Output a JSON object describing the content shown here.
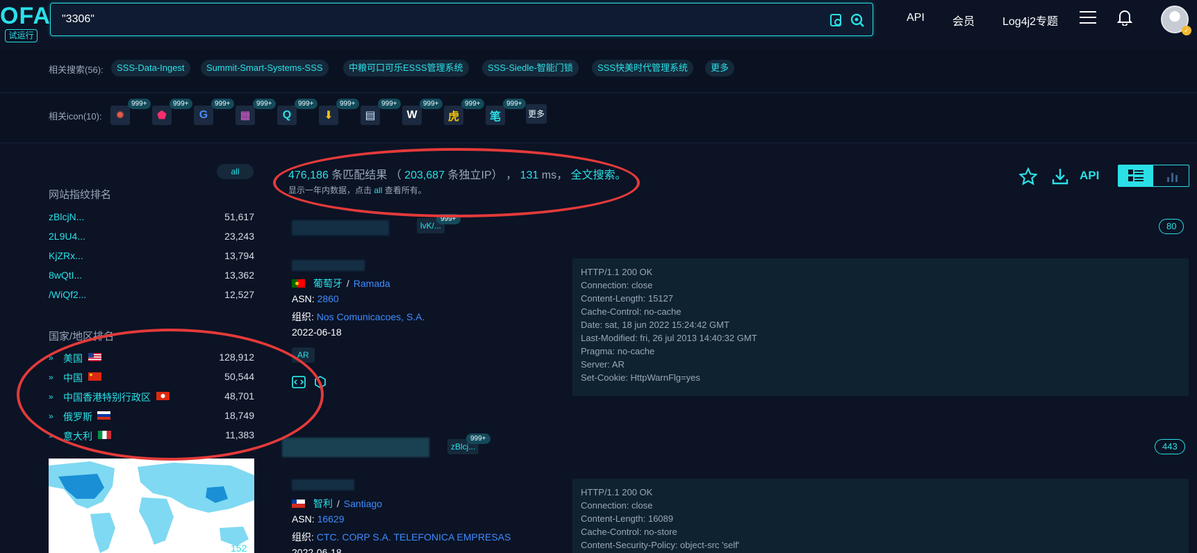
{
  "header": {
    "logo_text": "OFA",
    "logo_badge": "试运行",
    "search_value": "\"3306\"",
    "nav": [
      "API",
      "会员",
      "Log4j2专题"
    ]
  },
  "related_search": {
    "label": "相关搜索(56):",
    "items": [
      "SSS-Data-Ingest",
      "Summit-Smart-Systems-SSS",
      "中粮可口可乐ESSS管理系统",
      "SSS-Siedle-智能门锁",
      "SSS快美时代管理系统",
      "更多"
    ]
  },
  "related_icons": {
    "label": "相关icon(10):",
    "badges": [
      "999+",
      "999+",
      "999+",
      "999+",
      "999+",
      "999+",
      "999+",
      "999+",
      "999+",
      "999+"
    ],
    "glyphs": [
      "✹",
      "⬟",
      "G",
      "▦",
      "Q",
      "⬇",
      "▤",
      "W",
      "虎",
      "笔"
    ],
    "more": "更多"
  },
  "sidebar": {
    "all_label": "all",
    "fingerprint_title": "网站指纹排名",
    "fingerprints": [
      {
        "name": "zBlcjN...",
        "count": "51,617"
      },
      {
        "name": "2L9U4...",
        "count": "23,243"
      },
      {
        "name": "KjZRx...",
        "count": "13,794"
      },
      {
        "name": "8wQtI...",
        "count": "13,362"
      },
      {
        "name": "/WiQf2...",
        "count": "12,527"
      }
    ],
    "country_title": "国家/地区排名",
    "countries": [
      {
        "name": "美国",
        "count": "128,912"
      },
      {
        "name": "中国",
        "count": "50,544"
      },
      {
        "name": "中国香港特别行政区",
        "count": "48,701"
      },
      {
        "name": "俄罗斯",
        "count": "18,749"
      },
      {
        "name": "意大利",
        "count": "11,383"
      }
    ],
    "map_label": "152"
  },
  "summary": {
    "total": "476,186",
    "total_suffix": "条匹配结果",
    "paren_open": "（",
    "ip_count": "203,687",
    "ip_suffix": "条独立IP）",
    "comma": "，",
    "ms": "131",
    "ms_suffix": "ms，",
    "fulltext": "全文搜索。",
    "note_prefix": "显示一年内数据，点击",
    "note_all": "all",
    "note_suffix": "查看所有。",
    "api_label": "API"
  },
  "results": [
    {
      "ip_partial": "152.153",
      "tag": "lvK/...",
      "tag_count": "999+",
      "port": "80",
      "country": "葡萄牙",
      "city": "Ramada",
      "asn_label": "ASN:",
      "asn": "2860",
      "org_label": "组织:",
      "org": "Nos Comunicacoes, S.A.",
      "date": "2022-06-18",
      "product": "AR",
      "http": [
        "HTTP/1.1 200 OK",
        "Connection: close",
        "Content-Length: 15127",
        "Cache-Control: no-cache",
        "Date: sat, 18 jun 2022 15:24:42 GMT",
        "Last-Modified: fri, 26 jul 2013 14:40:32 GMT",
        "Pragma: no-cache",
        "Server: AR",
        "Set-Cookie: HttpWarnFlg=yes"
      ]
    },
    {
      "tag": "zBlcj...",
      "tag_count": "999+",
      "port": "443",
      "country": "智利",
      "city": "Santiago",
      "asn_label": "ASN:",
      "asn": "16629",
      "org_label": "组织:",
      "org": "CTC. CORP S.A. TELEFONICA EMPRESAS",
      "date": "2022-06-18",
      "http": [
        "HTTP/1.1 200 OK",
        "Connection: close",
        "Content-Length: 16089",
        "Cache-Control: no-store",
        "Content-Security-Policy: object-src 'self'"
      ]
    }
  ],
  "colors": {
    "accent": "#2ae0e6",
    "background": "#0b1325",
    "link": "#3f8cff",
    "annotation": "#e33a3a"
  }
}
